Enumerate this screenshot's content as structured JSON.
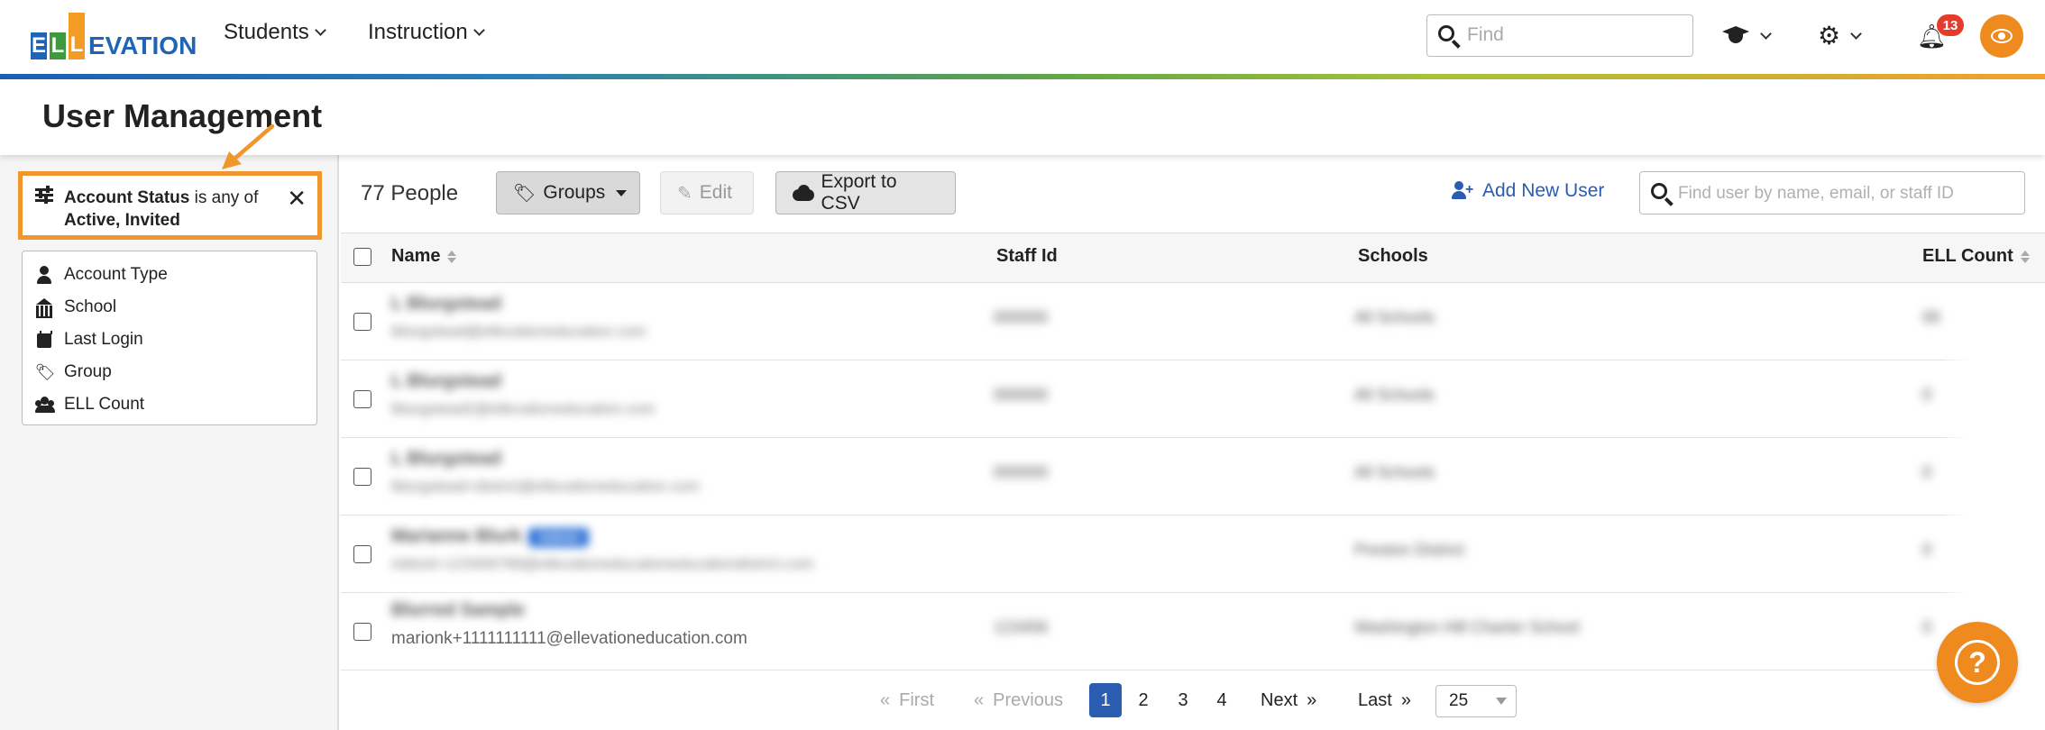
{
  "topnav": {
    "logo": {
      "letters": [
        "E",
        "L",
        "L"
      ],
      "rest": "EVATION"
    },
    "menu": [
      {
        "label": "Students"
      },
      {
        "label": "Instruction"
      }
    ],
    "find_placeholder": "Find",
    "notifications_count": "13",
    "icons": [
      "search-icon",
      "graduation-cap-icon",
      "gear-icon",
      "bell-icon",
      "eye-icon"
    ],
    "brand_colors": {
      "blue": "#2065b5",
      "green": "#3d9a3d",
      "orange": "#f39c24",
      "accent": "#ee8a1e"
    }
  },
  "page": {
    "title": "User Management"
  },
  "sidebar": {
    "active_filter": {
      "field": "Account Status",
      "operator": "is any of",
      "values": "Active, Invited"
    },
    "filters": [
      {
        "label": "Account Type",
        "icon": "person-icon"
      },
      {
        "label": "School",
        "icon": "school-building-icon"
      },
      {
        "label": "Last Login",
        "icon": "calendar-icon"
      },
      {
        "label": "Group",
        "icon": "tags-icon"
      },
      {
        "label": "ELL Count",
        "icon": "users-icon"
      }
    ]
  },
  "toolbar": {
    "people_count": "77 People",
    "groups_label": "Groups",
    "edit_label": "Edit",
    "export_label": "Export to CSV",
    "add_user_label": "Add New User",
    "search_placeholder": "Find user by name, email, or staff ID"
  },
  "table": {
    "columns": [
      "Name",
      "Staff Id",
      "Schools",
      "ELL Count"
    ],
    "rows": [
      {
        "name": "L Blurgstead",
        "email": "lblurgstead@ellevationeducation.com",
        "staff_id": "000000",
        "school": "All Schools",
        "ell": "00"
      },
      {
        "name": "L Blurgstead",
        "email": "lblurgstead2@ellevationeducation.com",
        "staff_id": "000000",
        "school": "All Schools",
        "ell": "0"
      },
      {
        "name": "L Blurgstead",
        "email": "lblurgstead+district@ellevationeducation.com",
        "staff_id": "000000",
        "school": "All Schools",
        "ell": "0"
      },
      {
        "name": "Marianne Blurk",
        "role": "Admin",
        "email": "mblurk+123456789@ellevationeducationeducationdistrict.com",
        "staff_id": "",
        "school": "Preston District",
        "ell": "0"
      },
      {
        "name": "Blurred Sample",
        "email": "marionk+1111111111@ellevationeducation.com",
        "staff_id": "123456",
        "school": "Washington Hill Charter School",
        "ell": "0"
      }
    ]
  },
  "pagination": {
    "first": "First",
    "previous": "Previous",
    "pages": [
      "1",
      "2",
      "3",
      "4"
    ],
    "current": "1",
    "next": "Next",
    "last": "Last",
    "page_size": "25",
    "laquo": "«",
    "raquo": "»"
  },
  "help": {
    "icon": "question-icon",
    "glyph": "?"
  }
}
